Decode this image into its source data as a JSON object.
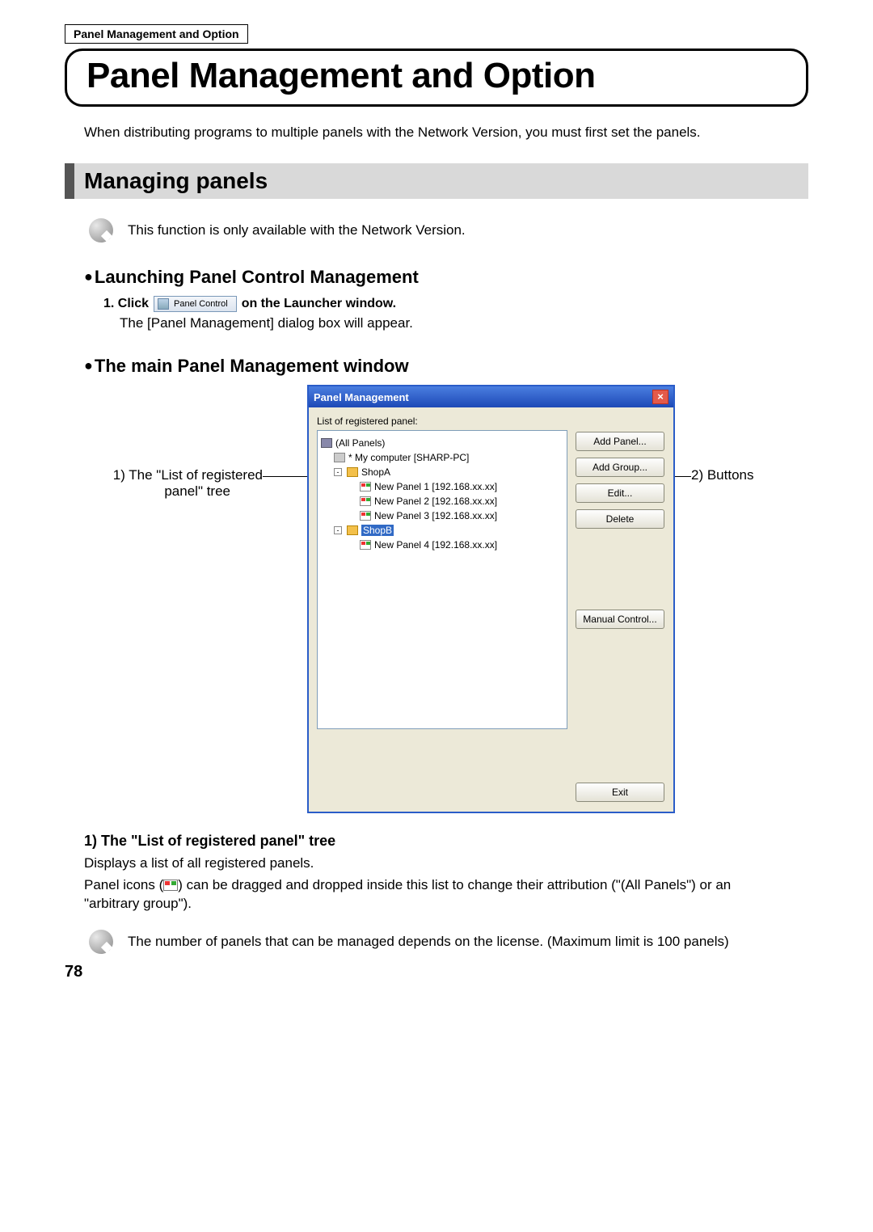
{
  "breadcrumb": "Panel Management and Option",
  "page_title": "Panel Management and Option",
  "intro": "When distributing programs to multiple panels with the Network Version, you must first set the panels.",
  "section1": {
    "heading": "Managing panels",
    "note": "This function is only available with the Network Version."
  },
  "launch": {
    "heading": "Launching Panel Control Management",
    "step_prefix": "1.  Click",
    "button_label": "Panel Control",
    "step_suffix": "on the Launcher window.",
    "result": "The [Panel Management] dialog box will appear."
  },
  "mainwin": {
    "heading": "The main Panel Management window",
    "callout_left_l1": "1) The \"List of registered",
    "callout_left_l2": "panel\" tree",
    "callout_right": "2) Buttons"
  },
  "dialog": {
    "title": "Panel Management",
    "list_label": "List of registered panel:",
    "tree": {
      "root": "(All Panels)",
      "mypc": "* My computer [SHARP-PC]",
      "groupA": "ShopA",
      "panelsA": [
        "New Panel 1 [192.168.xx.xx]",
        "New Panel 2 [192.168.xx.xx]",
        "New Panel 3 [192.168.xx.xx]"
      ],
      "groupB": "ShopB",
      "panelsB": [
        "New Panel 4 [192.168.xx.xx]"
      ]
    },
    "buttons": {
      "add_panel": "Add Panel...",
      "add_group": "Add Group...",
      "edit": "Edit...",
      "delete": "Delete",
      "manual": "Manual Control...",
      "exit": "Exit"
    }
  },
  "tree_section": {
    "heading": "1) The \"List of registered panel\" tree",
    "p1": "Displays a list of all registered panels.",
    "p2a": "Panel icons (",
    "p2b": ") can be dragged and dropped inside this list to change their attribution (\"(All Panels\") or an \"arbitrary group\").",
    "note": "The number of panels that can be managed depends on the license. (Maximum limit is 100 panels)"
  },
  "page_number": "78"
}
